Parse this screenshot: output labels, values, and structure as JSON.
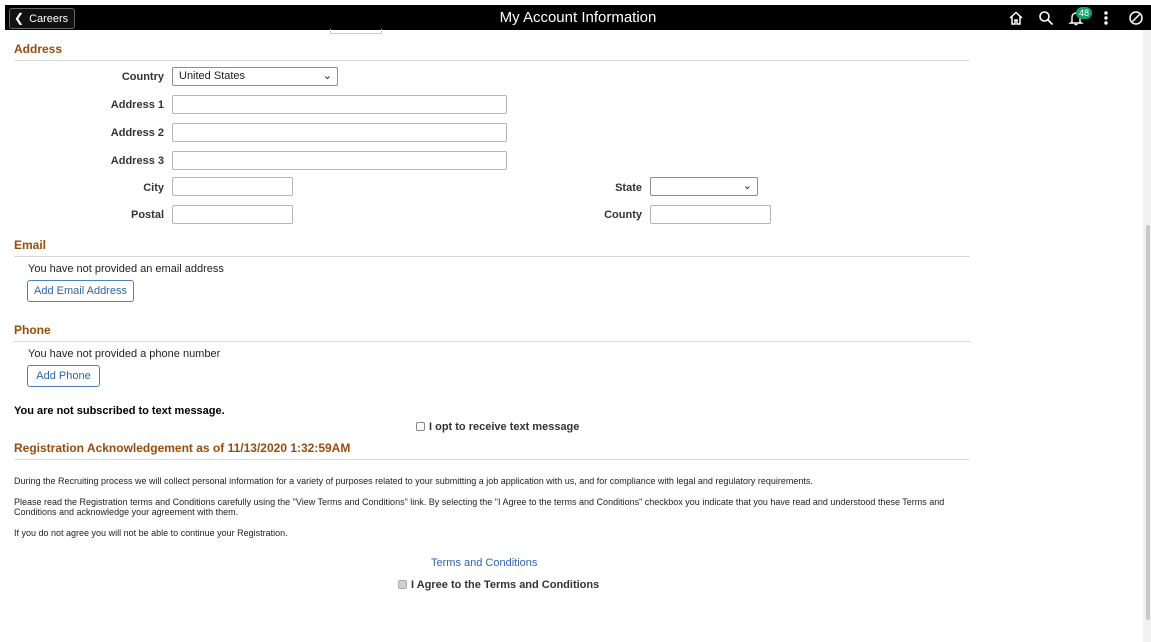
{
  "header": {
    "back_label": "Careers",
    "title": "My Account Information",
    "notification_count": "48"
  },
  "address": {
    "heading": "Address",
    "country_label": "Country",
    "country_value": "United States",
    "address1_label": "Address 1",
    "address2_label": "Address 2",
    "address3_label": "Address 3",
    "city_label": "City",
    "state_label": "State",
    "postal_label": "Postal",
    "county_label": "County"
  },
  "email": {
    "heading": "Email",
    "message": "You have not provided an email address",
    "add_button": "Add Email Address"
  },
  "phone": {
    "heading": "Phone",
    "message": "You have not provided a phone number",
    "add_button": "Add Phone"
  },
  "text_message": {
    "status": "You are not subscribed to text message.",
    "opt_in_label": "I opt to receive text message"
  },
  "registration": {
    "heading": "Registration Acknowledgement as of 11/13/2020 1:32:59AM",
    "paragraph1": "During the Recruiting process we will collect personal information for a variety of purposes related to your submitting a job application with us, and for compliance with legal and regulatory requirements.",
    "paragraph2": "Please read the Registration terms and Conditions carefully using the \"View Terms and Conditions\" link. By selecting the \"I Agree to the terms and Conditions\" checkbox you indicate that you have read and understood these Terms and Conditions and acknowledge your agreement with them.",
    "paragraph3": "If you do not agree you will not be able to continue your Registration.",
    "terms_link": "Terms and Conditions",
    "agree_label": "I Agree to the Terms and Conditions"
  }
}
